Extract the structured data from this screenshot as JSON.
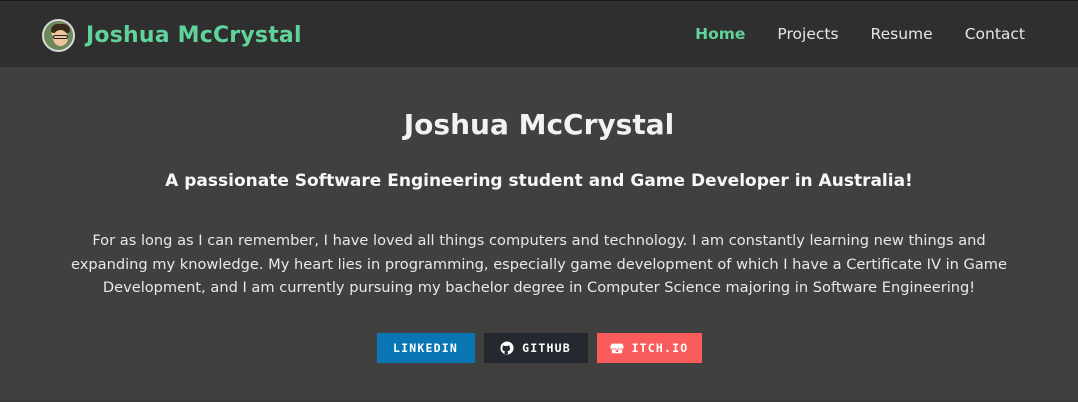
{
  "navbar": {
    "brand_name": "Joshua McCrystal",
    "links": [
      {
        "label": "Home",
        "active": true
      },
      {
        "label": "Projects",
        "active": false
      },
      {
        "label": "Resume",
        "active": false
      },
      {
        "label": "Contact",
        "active": false
      }
    ]
  },
  "hero": {
    "title": "Joshua McCrystal",
    "subtitle": "A passionate Software Engineering student and Game Developer in Australia!",
    "body": "For as long as I can remember, I have loved all things computers and technology. I am constantly learning new things and expanding my knowledge. My heart lies in programming, especially game development of which I have a Certificate IV in Game Development, and I am currently pursuing my bachelor degree in Computer Science majoring in Software Engineering!",
    "buttons": [
      {
        "label": "LINKEDIN",
        "icon": "none",
        "color": "#0a77b5"
      },
      {
        "label": "GITHUB",
        "icon": "github-icon",
        "color": "#24292f"
      },
      {
        "label": "ITCH.IO",
        "icon": "itchio-icon",
        "color": "#fa5c5c"
      }
    ]
  },
  "colors": {
    "accent": "#5fd39a",
    "background": "#404040",
    "navbar": "#2f2f2f"
  }
}
